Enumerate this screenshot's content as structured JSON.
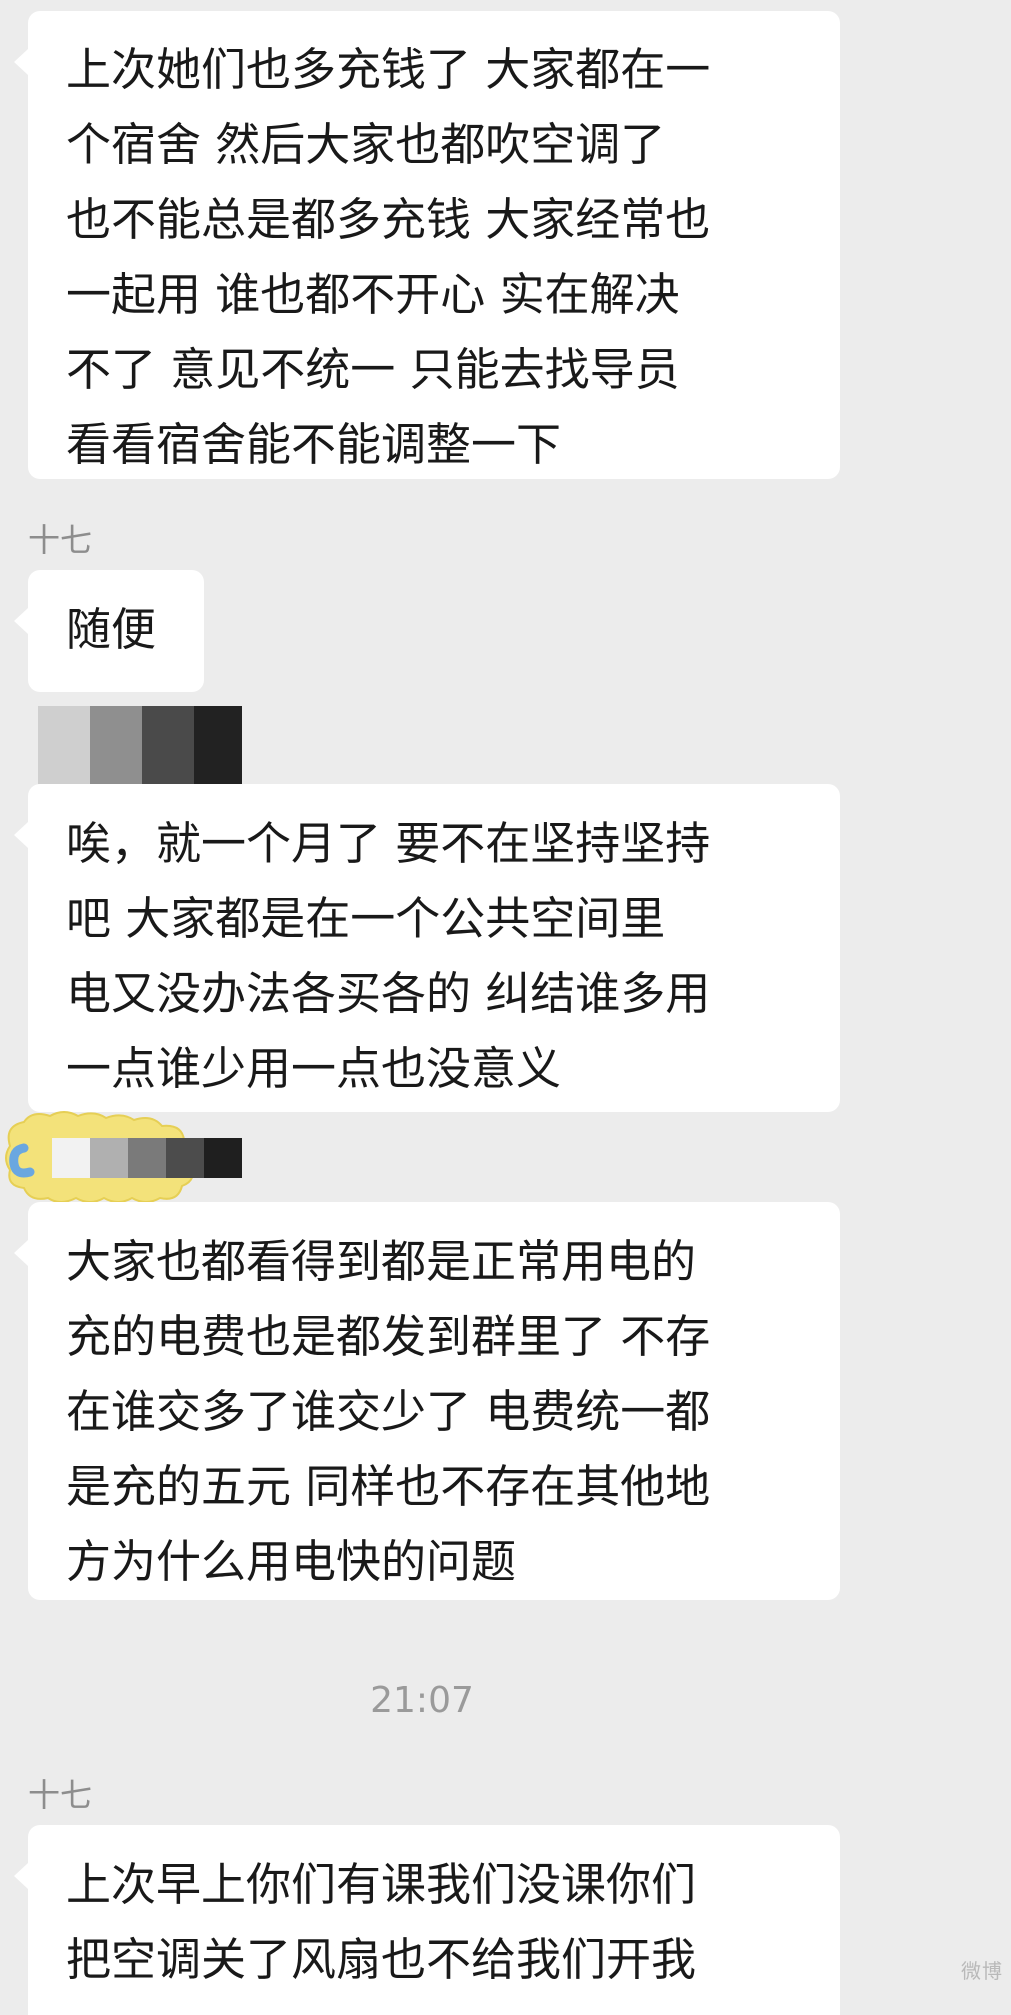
{
  "colors": {
    "background": "#ececec",
    "bubble": "#ffffff",
    "text": "#191919",
    "sender": "#8d8d8d",
    "timestamp": "#9a9a9a",
    "sticker_yellow": "#f3e27a"
  },
  "messages": [
    {
      "sender": "",
      "lines": [
        "上次她们也多充钱了 大家都在一",
        "个宿舍 然后大家也都吹空调了",
        "也不能总是都多充钱 大家经常也",
        "一起用 谁也都不开心 实在解决",
        "不了 意见不统一 只能去找导员",
        "看看宿舍能不能调整一下"
      ]
    },
    {
      "sender": "十七",
      "lines": [
        "随便"
      ]
    },
    {
      "sender": "",
      "lines": [
        "唉，就一个月了 要不在坚持坚持",
        "吧 大家都是在一个公共空间里",
        "电又没办法各买各的 纠结谁多用",
        "一点谁少用一点也没意义"
      ]
    },
    {
      "sender": "",
      "lines": [
        "大家也都看得到都是正常用电的",
        "充的电费也是都发到群里了 不存",
        "在谁交多了谁交少了 电费统一都",
        "是充的五元 同样也不存在其他地",
        "方为什么用电快的问题"
      ]
    },
    {
      "sender": "十七",
      "lines": [
        "上次早上你们有课我们没课你们",
        "把空调关了风扇也不给我们开我"
      ]
    }
  ],
  "timestamp": "21:07",
  "watermark": "微博"
}
